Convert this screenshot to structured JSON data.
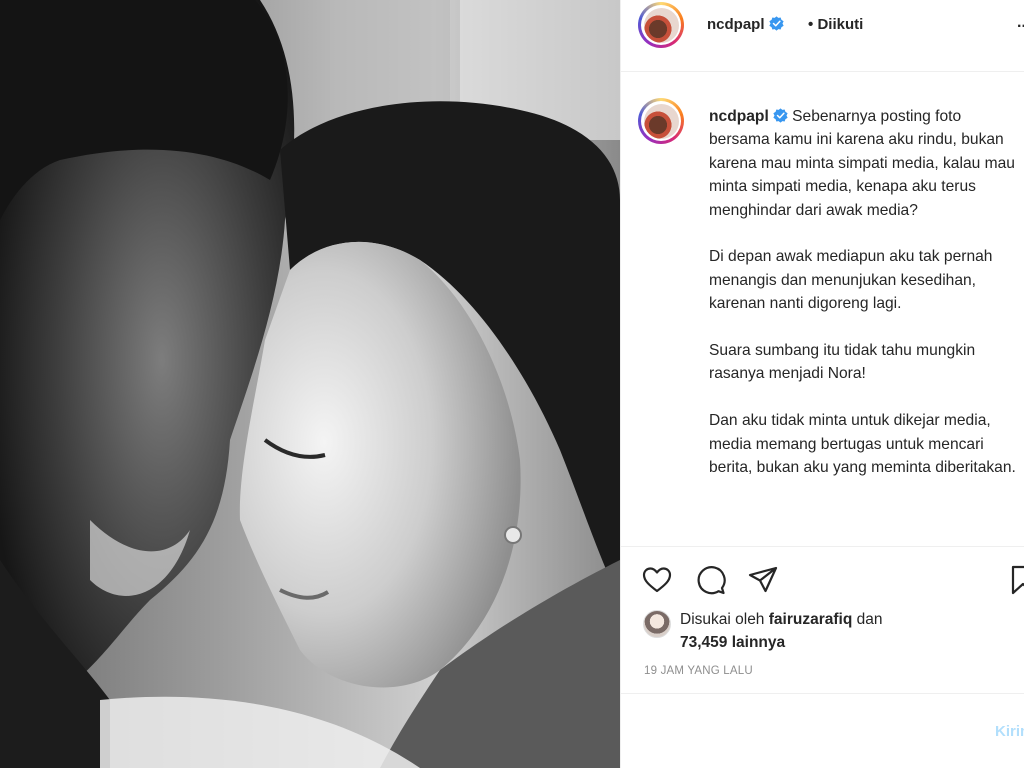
{
  "post": {
    "username": "ncdpapl",
    "follow_sep": "•",
    "follow_status": "Diikuti",
    "more": "..."
  },
  "caption": {
    "username": "ncdpapl",
    "paragraphs": [
      "Sebenarnya posting foto bersama kamu ini karena aku rindu, bukan karena mau minta simpati media, kalau mau minta simpati media, kenapa aku terus menghindar dari awak media?",
      "Di depan awak mediapun aku tak pernah menangis dan menunjukan kesedihan, karenan nanti digoreng lagi.",
      "Suara sumbang itu tidak tahu mungkin rasanya menjadi Nora!",
      "Dan aku tidak minta untuk dikejar media, media memang bertugas untuk mencari berita, bukan aku yang meminta diberitakan."
    ]
  },
  "actions": {
    "icons": [
      "heart-icon",
      "comment-icon",
      "share-icon",
      "bookmark-icon"
    ]
  },
  "likes": {
    "prefix": "Disukai oleh",
    "liker": "fairuzarafiq",
    "conj": "dan",
    "count": "73,459 lainnya"
  },
  "timestamp": "19 JAM YANG LALU",
  "comment_box": {
    "send_label": "Kirim"
  },
  "colors": {
    "verified": "#3897f0",
    "link_disabled": "#b2dffc",
    "muted": "#8e8e8e"
  }
}
